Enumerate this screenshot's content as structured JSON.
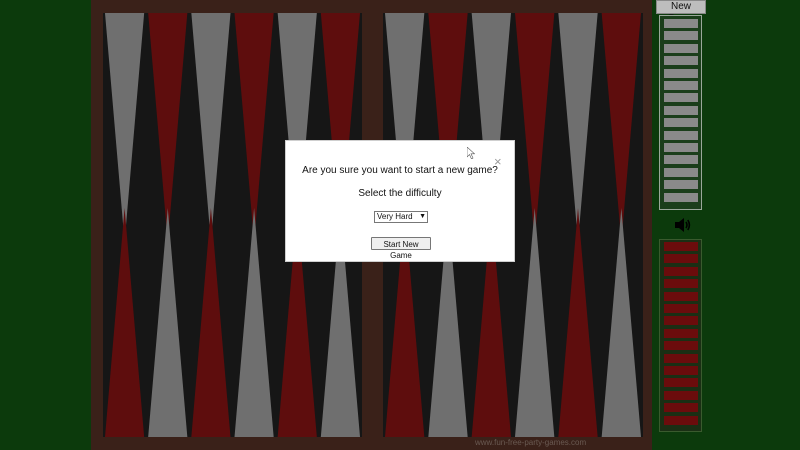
{
  "sidebar": {
    "new_game_label": "New Game",
    "top_stack_count": 15,
    "bottom_stack_count": 15,
    "sound_icon": "speaker-icon"
  },
  "board": {
    "watermark": "www.fun-free-party-games.com",
    "colors": {
      "frame": "#3a2119",
      "felt": "#161616",
      "red_point": "#5e0d0d",
      "gray_point": "#6f6f6f"
    }
  },
  "modal": {
    "question": "Are you sure you want to start a new game?",
    "subtitle": "Select the difficulty",
    "difficulty_selected": "Very Hard",
    "start_label": "Start New Game",
    "close_glyph": "×"
  }
}
